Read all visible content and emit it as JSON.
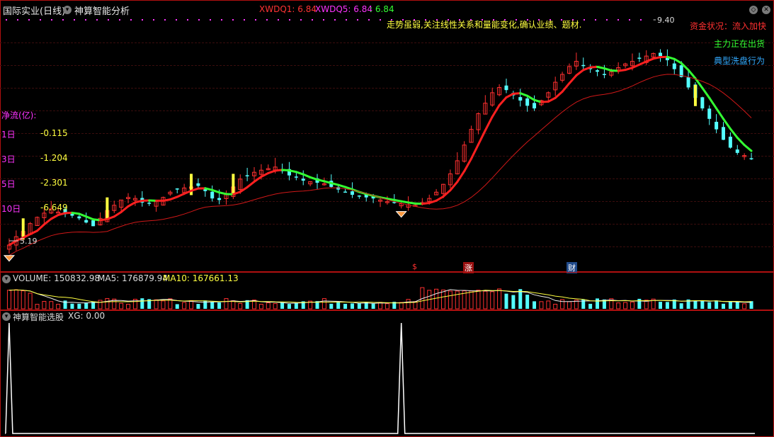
{
  "main_header": {
    "title": "国际实业(日线)",
    "indicator_name": "神算智能分析",
    "xwdq1_label": "XWDQ1: 6.84",
    "xwdq5_label": "XWDQ5: 6.84",
    "third_value": ": 6.84"
  },
  "signal_text": "走势虽弱,关注线性关系和量能变化,确认业绩、题材.",
  "fund_status": {
    "line1": "资金状况：流入加快",
    "line2": "主力正在出货",
    "line3": "典型洗盘行为"
  },
  "net_flow": {
    "title": "净流(亿):",
    "rows": [
      {
        "label": "1日",
        "value": "-0.115"
      },
      {
        "label": "3日",
        "value": "-1.204"
      },
      {
        "label": "5日",
        "value": "-2.301"
      },
      {
        "label": "10日",
        "value": "-6.649"
      }
    ]
  },
  "price_marks": {
    "high": "9.40",
    "low": "5.19"
  },
  "event_tags": [
    "$",
    "涨",
    "财"
  ],
  "volume_panel": {
    "label": "VOLUME: 150832.98",
    "ma5": "MA5: 176879.94",
    "ma10": "MA10: 167661.13"
  },
  "xg_panel": {
    "title": "神算智能选股",
    "value": "XG: 0.00"
  },
  "colors": {
    "up": "#ff3030",
    "down": "#54ffff",
    "ma_up": "#ff2020",
    "ma_down": "#33ff33",
    "ma_long": "#d01818",
    "yellow": "#ffff40",
    "magenta": "#ff33ff",
    "border": "#b01010"
  },
  "chart_data": {
    "type": "candlestick",
    "visible_price_range": [
      5.0,
      9.6
    ],
    "close_prices": [
      5.19,
      5.35,
      5.45,
      5.6,
      5.72,
      5.8,
      5.88,
      5.82,
      5.78,
      5.75,
      5.7,
      5.62,
      5.55,
      5.7,
      5.85,
      5.95,
      6.05,
      6.1,
      6.08,
      6.0,
      5.98,
      6.02,
      6.1,
      6.2,
      6.25,
      6.28,
      6.3,
      6.32,
      6.22,
      6.08,
      6.05,
      6.15,
      6.3,
      6.45,
      6.52,
      6.58,
      6.62,
      6.65,
      6.68,
      6.6,
      6.52,
      6.48,
      6.42,
      6.4,
      6.38,
      6.36,
      6.3,
      6.25,
      6.2,
      6.15,
      6.12,
      6.1,
      6.08,
      6.05,
      6.02,
      6.0,
      5.98,
      5.96,
      5.95,
      6.0,
      6.08,
      6.2,
      6.35,
      6.55,
      6.8,
      7.1,
      7.4,
      7.7,
      7.9,
      8.1,
      8.2,
      8.15,
      8.05,
      7.95,
      7.85,
      7.8,
      7.95,
      8.1,
      8.3,
      8.45,
      8.6,
      8.7,
      8.62,
      8.55,
      8.5,
      8.45,
      8.5,
      8.58,
      8.65,
      8.7,
      8.75,
      8.8,
      8.85,
      8.8,
      8.72,
      8.55,
      8.4,
      8.2,
      8.0,
      7.8,
      7.6,
      7.4,
      7.2,
      7.05,
      6.95,
      6.9,
      6.84
    ],
    "volume_max": 32000,
    "xg_signals": [
      0,
      56
    ]
  }
}
